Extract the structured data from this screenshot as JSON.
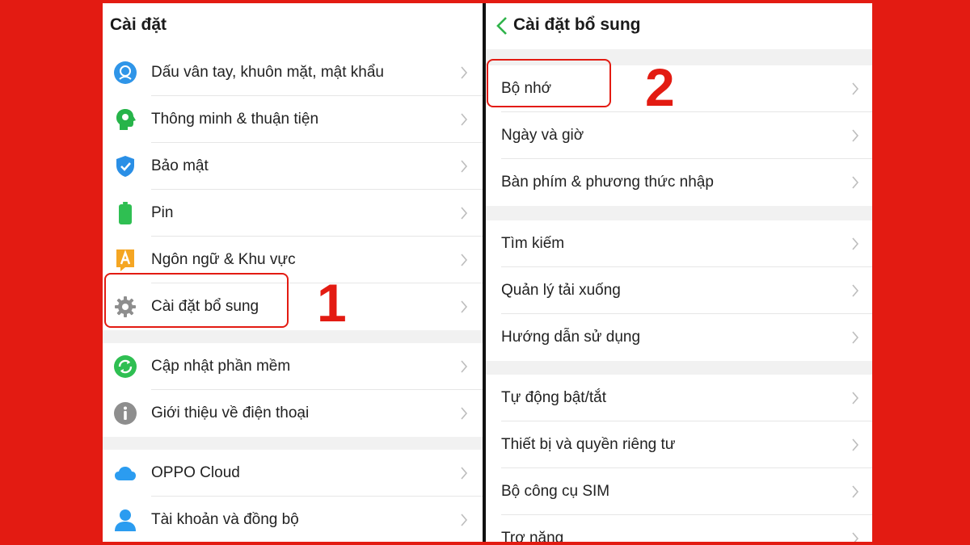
{
  "left_panel": {
    "title": "Cài đặt",
    "items": [
      {
        "label": "Dấu vân tay, khuôn mặt, mật khẩu",
        "icon": "fingerprint-face-icon"
      },
      {
        "label": "Thông minh & thuận tiện",
        "icon": "smart-head-icon"
      },
      {
        "label": "Bảo mật",
        "icon": "shield-check-icon"
      },
      {
        "label": "Pin",
        "icon": "battery-icon"
      },
      {
        "label": "Ngôn ngữ & Khu vực",
        "icon": "language-a-icon"
      },
      {
        "label": "Cài đặt bổ sung",
        "icon": "gear-icon"
      },
      {
        "label": "Cập nhật phần mềm",
        "icon": "update-icon"
      },
      {
        "label": "Giới thiệu về điện thoại",
        "icon": "info-icon"
      },
      {
        "label": "OPPO Cloud",
        "icon": "cloud-icon"
      },
      {
        "label": "Tài khoản và đồng bộ",
        "icon": "account-icon"
      }
    ]
  },
  "right_panel": {
    "title": "Cài đặt bổ sung",
    "items": [
      {
        "label": "Bộ nhớ"
      },
      {
        "label": "Ngày và giờ"
      },
      {
        "label": "Bàn phím & phương thức nhập"
      },
      {
        "label": "Tìm kiếm"
      },
      {
        "label": "Quản lý tải xuống"
      },
      {
        "label": "Hướng dẫn sử dụng"
      },
      {
        "label": "Tự động bật/tắt"
      },
      {
        "label": "Thiết bị và quyền riêng tư"
      },
      {
        "label": "Bộ công cụ SIM"
      },
      {
        "label": "Trợ năng"
      }
    ]
  },
  "annotations": {
    "step1": "1",
    "step2": "2"
  },
  "colors": {
    "background": "#e31b12",
    "accent_green": "#2fb34a",
    "highlight_red": "#e31b12"
  }
}
